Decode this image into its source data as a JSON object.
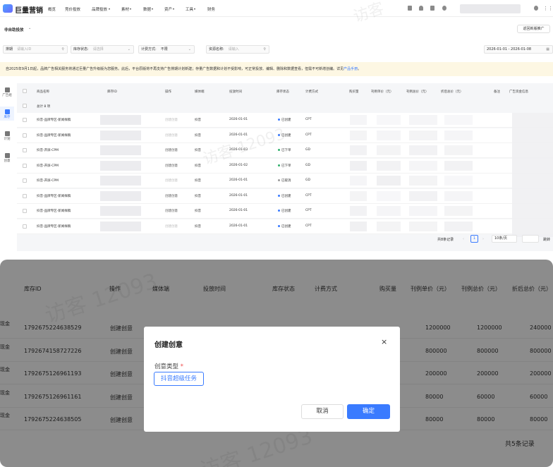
{
  "nav": {
    "brand": "巨量营销",
    "items": [
      "概览",
      "竞价投放",
      "品牌投放",
      "素材",
      "数据",
      "资产",
      "工具",
      "财务"
    ],
    "dropdown_flags": [
      false,
      false,
      true,
      true,
      true,
      true,
      true,
      false
    ]
  },
  "subheader": {
    "title": "非自助投放",
    "back_button": "返回新版推广"
  },
  "filters": [
    {
      "label": "排期",
      "placeholder": "请输入ID",
      "icon": "search-icon"
    },
    {
      "label": "库存状态:",
      "placeholder": "请选择",
      "icon": "chevron-down-icon"
    },
    {
      "label": "计费方式:",
      "value": "不限",
      "icon": "chevron-down-icon"
    },
    {
      "label": "资源名称:",
      "placeholder": "请输入",
      "icon": "search-icon"
    }
  ],
  "date_range": "2026-01-01 - 2026-01-08",
  "notice": {
    "text": "自2025年9月1日起，品牌广告相关服务将通过巨量广告升级版为您服务。此后，平台原版将不再支持广告排期计划新建；存量广告数据和计划不受影响，可正常投放、编辑、删除和数据查看，但需不可新增创编。详见",
    "link": "产品手册",
    "end": "。"
  },
  "sidebar": [
    {
      "label": "广告组",
      "icon": "folder-icon",
      "active": false
    },
    {
      "label": "库存",
      "icon": "inventory-icon",
      "active": true
    },
    {
      "label": "计划",
      "icon": "plan-icon",
      "active": false
    },
    {
      "label": "创意",
      "icon": "idea-icon",
      "active": false
    }
  ],
  "table": {
    "headers": [
      "商品名称",
      "库存ID",
      "操作",
      "媒体端",
      "投放时间",
      "库存状态",
      "计费方式",
      "购买量",
      "刊例单价（元）",
      "刊例总价（元）",
      "折后总价（元）",
      "备注",
      "广告资金信息"
    ],
    "total_label": "总计 8 项",
    "rows": [
      {
        "name": "抖音-品牌专区-新闻样稿",
        "action": "创建创意",
        "action_enabled": false,
        "media": "抖音",
        "time": "2026-01-01",
        "status": "已创建",
        "status_color": "#3a7bff",
        "billing": "CPT"
      },
      {
        "name": "抖音-品牌专区-新闻样稿",
        "action": "创建创意",
        "action_enabled": false,
        "media": "抖音",
        "time": "2026-01-01",
        "status": "已创建",
        "status_color": "#3a7bff",
        "billing": "CPT"
      },
      {
        "name": "抖音-开屏-CPM",
        "action": "创建创意",
        "action_enabled": true,
        "media": "抖音",
        "time": "2026-01-03",
        "status": "已下单",
        "status_color": "#31b16b",
        "billing": "GD"
      },
      {
        "name": "抖音-开屏-CPM",
        "action": "创建创意",
        "action_enabled": true,
        "media": "抖音",
        "time": "2026-01-02",
        "status": "已下单",
        "status_color": "#31b16b",
        "billing": "GD"
      },
      {
        "name": "抖音-开屏-CPM",
        "action": "创建创意",
        "action_enabled": false,
        "media": "抖音",
        "time": "2026-01-01",
        "status": "已取消",
        "status_color": "#9a9a9a",
        "billing": "GD"
      },
      {
        "name": "抖音-品牌专区-新闻样稿",
        "action": "创建创意",
        "action_enabled": true,
        "media": "抖音",
        "time": "2026-01-01",
        "status": "已创建",
        "status_color": "#3a7bff",
        "billing": "CPT"
      },
      {
        "name": "抖音-品牌专区-新闻样稿",
        "action": "创建创意",
        "action_enabled": true,
        "media": "抖音",
        "time": "2026-01-01",
        "status": "已创建",
        "status_color": "#3a7bff",
        "billing": "CPT"
      },
      {
        "name": "抖音-品牌专区-新闻样稿",
        "action": "创建创意",
        "action_enabled": false,
        "media": "抖音",
        "time": "2026-01-01",
        "status": "已创建",
        "status_color": "#3a7bff",
        "billing": "CPT"
      }
    ]
  },
  "pager": {
    "total": "共8条记录",
    "page": "1",
    "size": "10条/页",
    "goto": "跳转"
  },
  "zoom": {
    "headers": [
      "库存ID",
      "操作",
      "媒体端",
      "投放时间",
      "库存状态",
      "计费方式",
      "购买量",
      "刊例单价（元）",
      "刊例总价（元）",
      "折后总价（元）"
    ],
    "left_label": "现金",
    "rows": [
      {
        "id": "1792675224638529",
        "action": "创建创意",
        "unit": "1200000",
        "total": "1200000",
        "discount": "240000"
      },
      {
        "id": "1792674158727226",
        "action": "创建创意",
        "unit": "800000",
        "total": "800000",
        "discount": "800000"
      },
      {
        "id": "1792675126961193",
        "action": "创建创意",
        "unit": "200000",
        "total": "200000",
        "discount": "200000"
      },
      {
        "id": "1792675126961161",
        "action": "创建创意",
        "unit": "80000",
        "total": "60000",
        "discount": "60000"
      },
      {
        "id": "1792675224638505",
        "action": "创建创意",
        "unit": "80000",
        "total": "80000",
        "discount": "80000"
      }
    ],
    "total": "共5条记录"
  },
  "dialog": {
    "title": "创建创意",
    "field_label": "创意类型",
    "required_mark": "*",
    "option": "抖音超级任务",
    "cancel": "取消",
    "confirm": "确定"
  },
  "colors": {
    "primary": "#3a7bff",
    "notice_bg": "#fdf7e3"
  }
}
